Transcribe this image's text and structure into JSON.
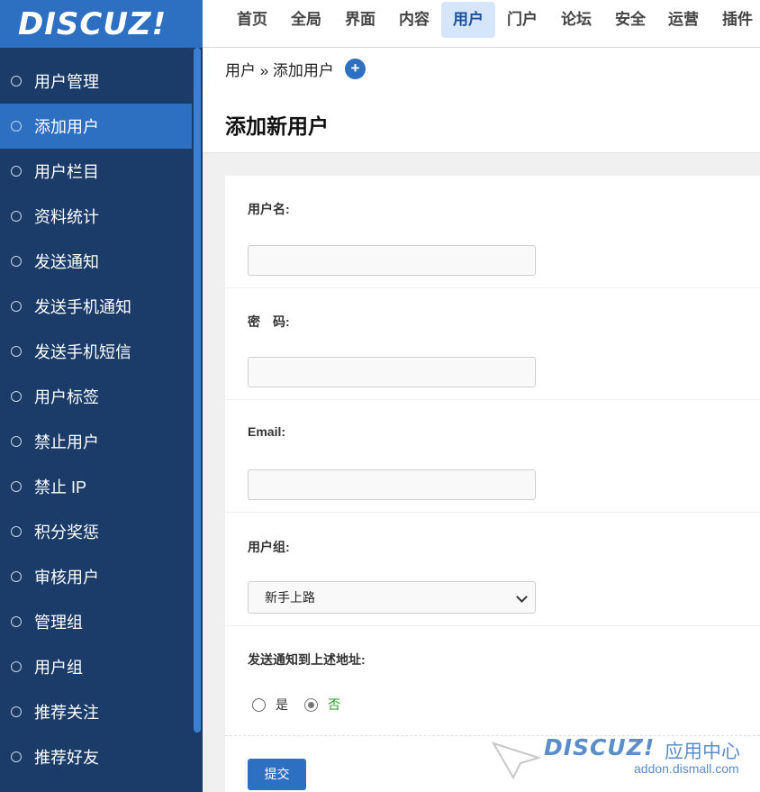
{
  "logo": {
    "text": "DISCUZ!"
  },
  "topnav": {
    "items": [
      {
        "label": "首页",
        "active": false
      },
      {
        "label": "全局",
        "active": false
      },
      {
        "label": "界面",
        "active": false
      },
      {
        "label": "内容",
        "active": false
      },
      {
        "label": "用户",
        "active": true
      },
      {
        "label": "门户",
        "active": false
      },
      {
        "label": "论坛",
        "active": false
      },
      {
        "label": "安全",
        "active": false
      },
      {
        "label": "运营",
        "active": false
      },
      {
        "label": "插件",
        "active": false
      }
    ]
  },
  "sidebar": {
    "items": [
      {
        "label": "用户管理",
        "active": false
      },
      {
        "label": "添加用户",
        "active": true
      },
      {
        "label": "用户栏目",
        "active": false
      },
      {
        "label": "资料统计",
        "active": false
      },
      {
        "label": "发送通知",
        "active": false
      },
      {
        "label": "发送手机通知",
        "active": false
      },
      {
        "label": "发送手机短信",
        "active": false
      },
      {
        "label": "用户标签",
        "active": false
      },
      {
        "label": "禁止用户",
        "active": false
      },
      {
        "label": "禁止 IP",
        "active": false
      },
      {
        "label": "积分奖惩",
        "active": false
      },
      {
        "label": "审核用户",
        "active": false
      },
      {
        "label": "管理组",
        "active": false
      },
      {
        "label": "用户组",
        "active": false
      },
      {
        "label": "推荐关注",
        "active": false
      },
      {
        "label": "推荐好友",
        "active": false
      }
    ]
  },
  "breadcrumb": {
    "text": "用户 » 添加用户",
    "plus_icon": "plus-circle-icon"
  },
  "page": {
    "title": "添加新用户"
  },
  "form": {
    "username_label": "用户名:",
    "username_value": "",
    "password_label": "密　码:",
    "password_value": "",
    "email_label": "Email:",
    "email_value": "",
    "group_label": "用户组:",
    "group_selected": "新手上路",
    "notify_label": "发送通知到上述地址:",
    "notify_yes": "是",
    "notify_no": "否",
    "notify_selected": "否",
    "submit_label": "提交"
  },
  "watermark": {
    "brand": "DISCUZ!",
    "cn": "应用中心",
    "url": "addon.dismall.com"
  },
  "colors": {
    "accent": "#2d6fc1",
    "sidebar_bg": "#1b3c68",
    "green_text": "#2a9a2a"
  }
}
